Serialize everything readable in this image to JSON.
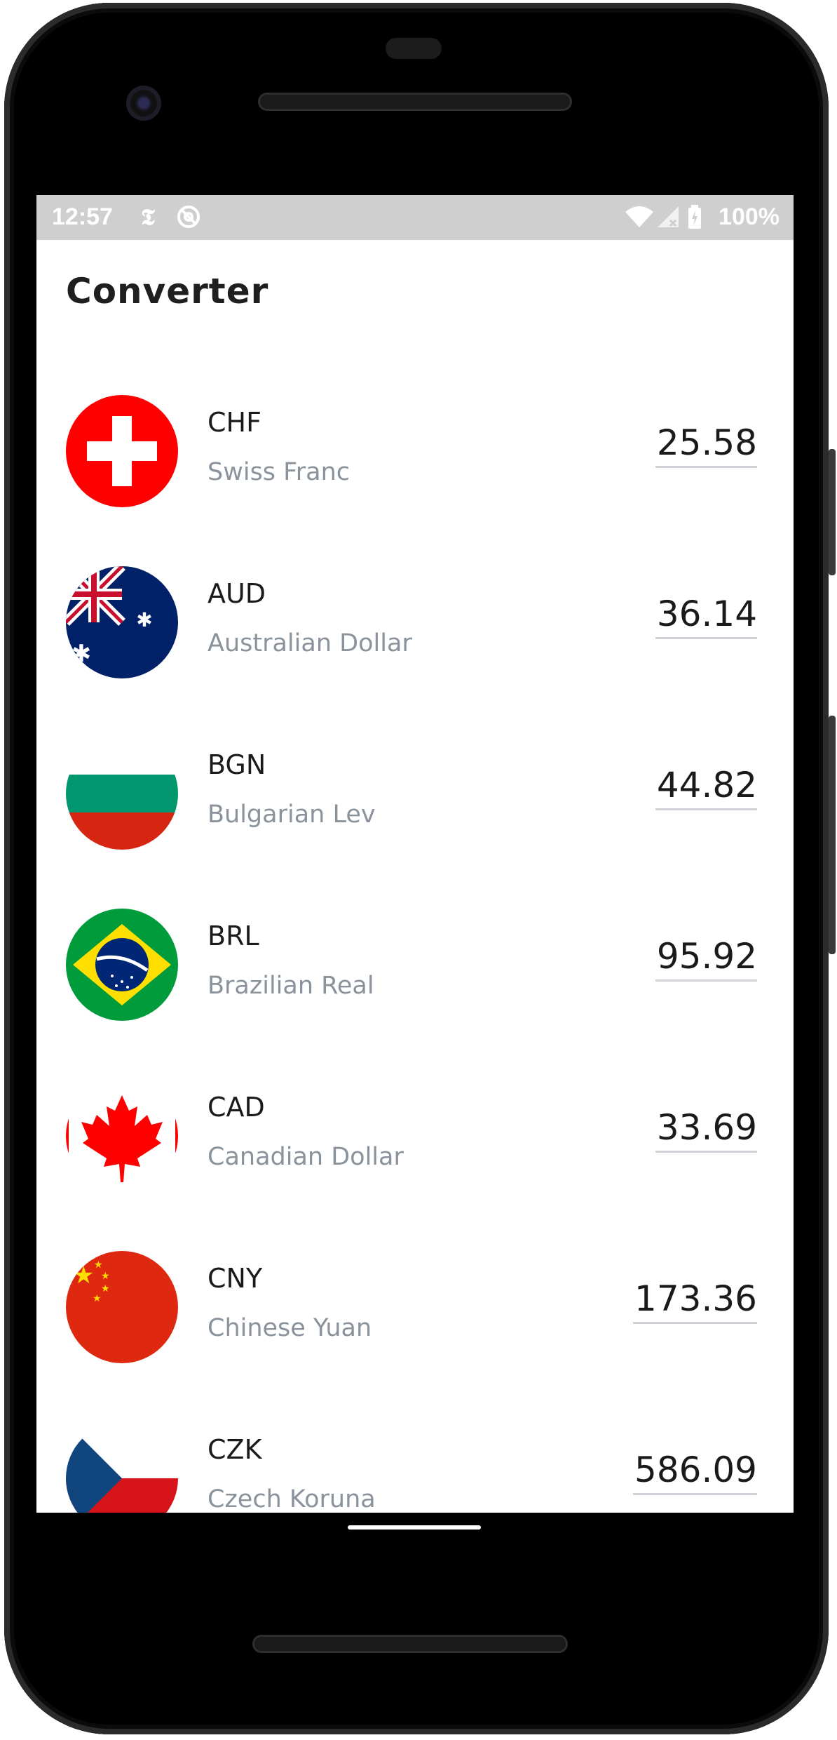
{
  "status_bar": {
    "time": "12:57",
    "notification_icons": [
      "nyt-icon",
      "at-sign-icon"
    ],
    "system_icons": [
      "wifi-icon",
      "signal-icon",
      "battery-icon"
    ],
    "battery_text": "100%"
  },
  "app": {
    "title": "Converter"
  },
  "currencies": [
    {
      "code": "CHF",
      "name": "Swiss Franc",
      "amount": "25.58",
      "flag": "switzerland-flag-icon"
    },
    {
      "code": "AUD",
      "name": "Australian Dollar",
      "amount": "36.14",
      "flag": "australia-flag-icon"
    },
    {
      "code": "BGN",
      "name": "Bulgarian Lev",
      "amount": "44.82",
      "flag": "bulgaria-flag-icon"
    },
    {
      "code": "BRL",
      "name": "Brazilian Real",
      "amount": "95.92",
      "flag": "brazil-flag-icon"
    },
    {
      "code": "CAD",
      "name": "Canadian Dollar",
      "amount": "33.69",
      "flag": "canada-flag-icon"
    },
    {
      "code": "CNY",
      "name": "Chinese Yuan",
      "amount": "173.36",
      "flag": "china-flag-icon"
    },
    {
      "code": "CZK",
      "name": "Czech Koruna",
      "amount": "586.09",
      "flag": "czech-flag-icon"
    }
  ],
  "colors": {
    "status_bar_bg": "#cfcfcf",
    "secondary_text": "#8a929c",
    "underline": "#cfd3d8"
  }
}
